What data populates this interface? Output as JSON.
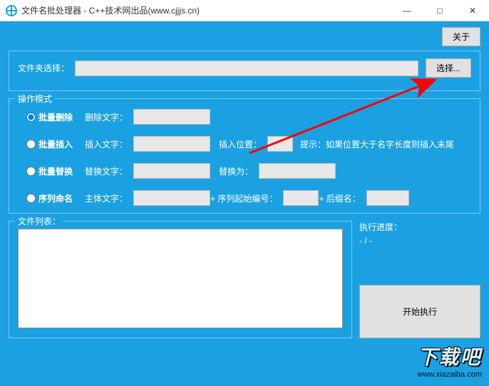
{
  "window": {
    "title": "文件名批处理器 - C++技术网出品(www.cjjjs.cn)",
    "minimize": "—",
    "maximize": "□",
    "close": "✕"
  },
  "buttons": {
    "about": "关于",
    "select": "选择...",
    "start": "开始执行"
  },
  "folder": {
    "label": "文件夹选择：",
    "value": ""
  },
  "modes": {
    "group_title": "操作模式",
    "batch_delete": {
      "radio": "批量删除",
      "delete_text_label": "删除文字：",
      "delete_text": ""
    },
    "batch_insert": {
      "radio": "批量插入",
      "insert_text_label": "插入文字：",
      "insert_text": "",
      "pos_label": "插入位置：",
      "pos": "",
      "hint_prefix": "提示：",
      "hint": "如果位置大于名字长度则插入末尾"
    },
    "batch_replace": {
      "radio": "批量替换",
      "replace_text_label": "替换文字：",
      "replace_text": "",
      "to_label": "替换为：",
      "to": ""
    },
    "sequence": {
      "radio": "序列命名",
      "body_label": "主体文字：",
      "body": "",
      "plus1": " + 序列起始编号：",
      "start": "",
      "plus2": " + 后缀名：",
      "suffix": ""
    }
  },
  "filelist": {
    "title": "文件列表：",
    "value": ""
  },
  "progress": {
    "label": "执行进度：",
    "value": "- / -"
  },
  "watermark": {
    "big": "下载吧",
    "small": "www.xiazaiba.com"
  }
}
